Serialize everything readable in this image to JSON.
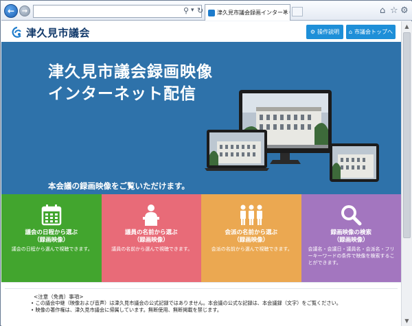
{
  "browser": {
    "tab_title": "津久見市議会録画インターネット…",
    "search_icon": "search-icon",
    "refresh_icon": "refresh-icon"
  },
  "header": {
    "logo_text": "津久見市議会",
    "manual_button": "操作説明",
    "top_button": "市議会トップへ"
  },
  "hero": {
    "title_line1": "津久見市議会録画映像",
    "title_line2": "インターネット配信",
    "subtitle": "本会議の録画映像をご覧いただけます。"
  },
  "cards": [
    {
      "title_line1": "議会の日程から選ぶ",
      "title_line2": "（録画映像）",
      "desc": "議会の日程から選んで視聴できます。",
      "color": "#42a52e",
      "icon": "calendar-icon"
    },
    {
      "title_line1": "議員の名前から選ぶ",
      "title_line2": "（録画映像）",
      "desc": "議員の名前から選んで視聴できます。",
      "color": "#e86b78",
      "icon": "speaker-podium-icon"
    },
    {
      "title_line1": "会派の名前から選ぶ",
      "title_line2": "（録画映像）",
      "desc": "会派の名前から選んで視聴できます。",
      "color": "#eba851",
      "icon": "group-icon"
    },
    {
      "title_line1": "録画映像の検索",
      "title_line2": "（録画映像）",
      "desc": "会議名・会議日・議員名・会派名・フリーキーワードの条件で映像を検索することができます。",
      "color": "#a376bf",
      "icon": "magnifier-icon"
    }
  ],
  "notice": {
    "title": "<注意（免責）事項>",
    "items": [
      "この議会中継（映像および音声）は津久見市議会の公式記録ではありません。本会議の公式な記録は、本会議録（文字）をご覧ください。",
      "映像の著作権は、津久見市議会に帰属しています。無断使用、無断掲載を禁じます。"
    ]
  }
}
